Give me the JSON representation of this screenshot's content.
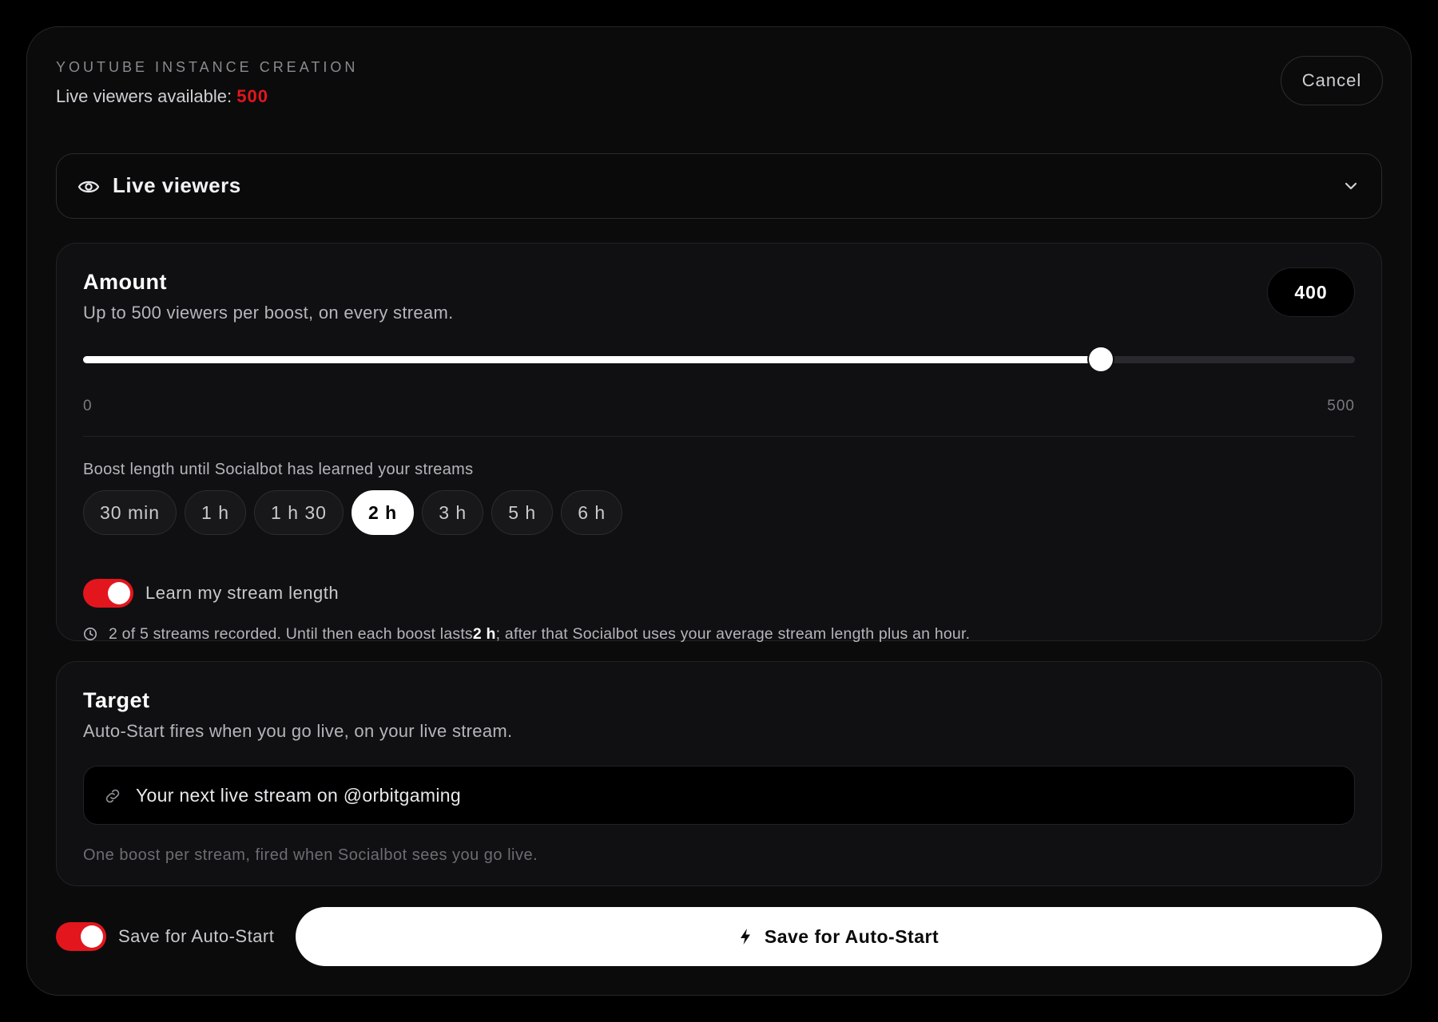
{
  "header": {
    "eyebrow": "YOUTUBE INSTANCE CREATION",
    "available_label": "Live viewers available: ",
    "available_value": "500",
    "cancel_label": "Cancel"
  },
  "service_select": {
    "icon": "eye-icon",
    "selected": "Live viewers",
    "chevron_icon": "chevron-down-icon"
  },
  "amount": {
    "title": "Amount",
    "subtitle": "Up to 500 viewers per boost, on every stream.",
    "value": "400",
    "slider": {
      "min": 0,
      "max": 500,
      "value": 400,
      "min_label": "0",
      "max_label": "500"
    },
    "length_label": "Boost length until Socialbot has learned your streams",
    "length_options": [
      {
        "label": "30 min",
        "active": false
      },
      {
        "label": "1 h",
        "active": false
      },
      {
        "label": "1 h 30",
        "active": false
      },
      {
        "label": "2 h",
        "active": true
      },
      {
        "label": "3 h",
        "active": false
      },
      {
        "label": "5 h",
        "active": false
      },
      {
        "label": "6 h",
        "active": false
      }
    ],
    "learn_toggle": {
      "label": "Learn my stream length",
      "on": true
    },
    "note": {
      "icon": "clock-icon",
      "before": "2 of 5 streams recorded. Until then each boost lasts ",
      "bold": "2 h",
      "after": "; after that Socialbot uses your average stream length plus an hour."
    }
  },
  "target": {
    "title": "Target",
    "subtitle": "Auto-Start fires when you go live, on your live stream.",
    "input_icon": "link-icon",
    "input_value": "Your next live stream on @orbitgaming",
    "footnote": "One boost per stream, fired when Socialbot sees you go live."
  },
  "footer": {
    "toggle_label": "Save for Auto-Start",
    "toggle_on": true,
    "save_label": "Save for Auto-Start",
    "save_icon": "bolt-icon"
  },
  "colors": {
    "accent": "#e3161d",
    "background": "#000000",
    "panel": "#0b0b0c",
    "card": "#101012"
  }
}
